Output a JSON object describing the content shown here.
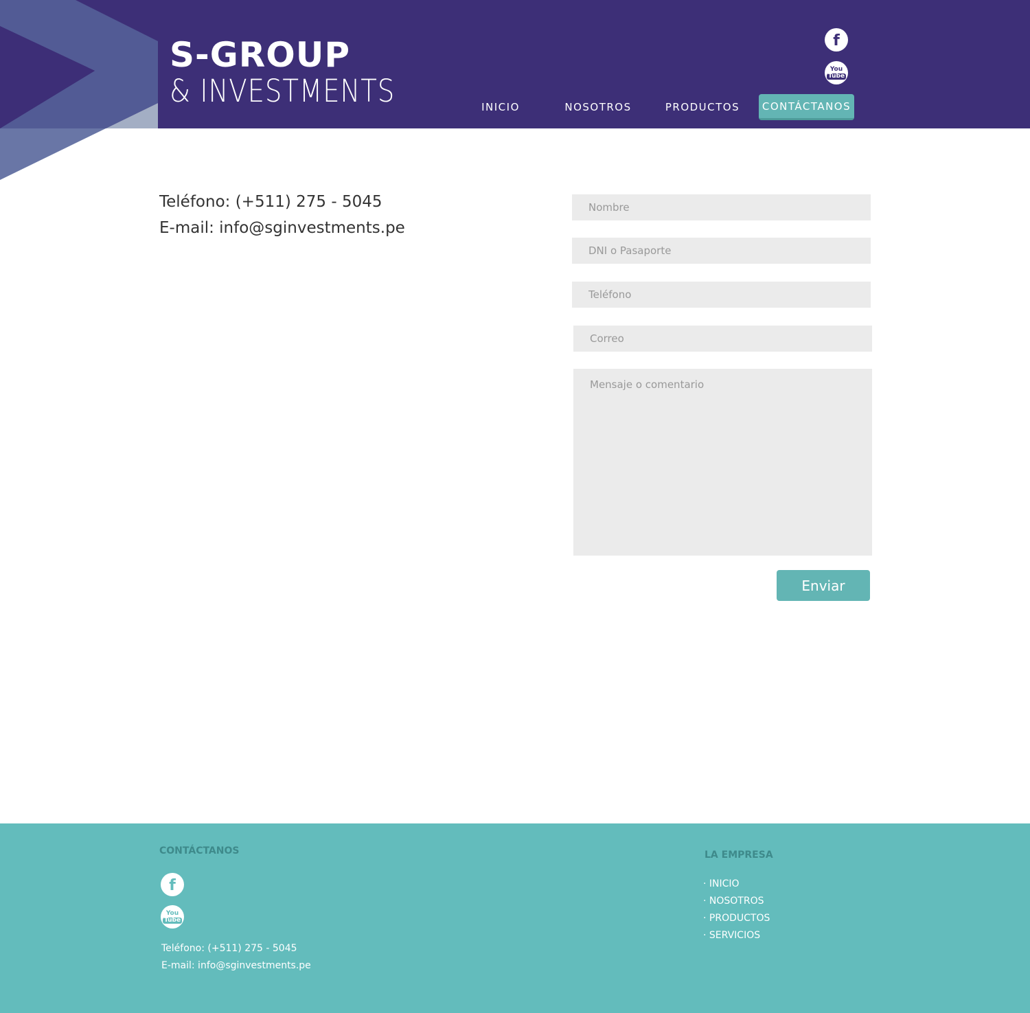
{
  "brand": {
    "line1": "S-GROUP",
    "line2": "& INVESTMENTS"
  },
  "header": {
    "social": [
      {
        "name": "facebook-icon",
        "glyph": "f"
      },
      {
        "name": "youtube-icon",
        "glyph_top": "You",
        "glyph_bottom": "Tube"
      }
    ],
    "nav": [
      {
        "label": "INICIO",
        "active": false
      },
      {
        "label": "NOSOTROS",
        "active": false
      },
      {
        "label": "PRODUCTOS",
        "active": false
      },
      {
        "label": "CONTÁCTANOS",
        "active": true
      }
    ]
  },
  "contact": {
    "phone": "Teléfono: (+511) 275 - 5045",
    "email": "E-mail: info@sginvestments.pe"
  },
  "form": {
    "nombre_placeholder": "Nombre",
    "dni_placeholder": "DNI o Pasaporte",
    "telefono_placeholder": "Teléfono",
    "correo_placeholder": "Correo",
    "mensaje_placeholder": "Mensaje o comentario",
    "submit_label": "Enviar"
  },
  "footer": {
    "contact_title": "CONTÁCTANOS",
    "phone": "Teléfono: (+511) 275 - 5045",
    "email": "E-mail: info@sginvestments.pe",
    "company_title": "LA EMPRESA",
    "links": [
      "· INICIO",
      "· NOSOTROS",
      "· PRODUCTOS",
      "· SERVICIOS"
    ]
  },
  "colors": {
    "header_bg": "#3d2f77",
    "accent": "#63b5b4",
    "footer_bg": "#63bcbc",
    "field_bg": "#ebebeb"
  }
}
